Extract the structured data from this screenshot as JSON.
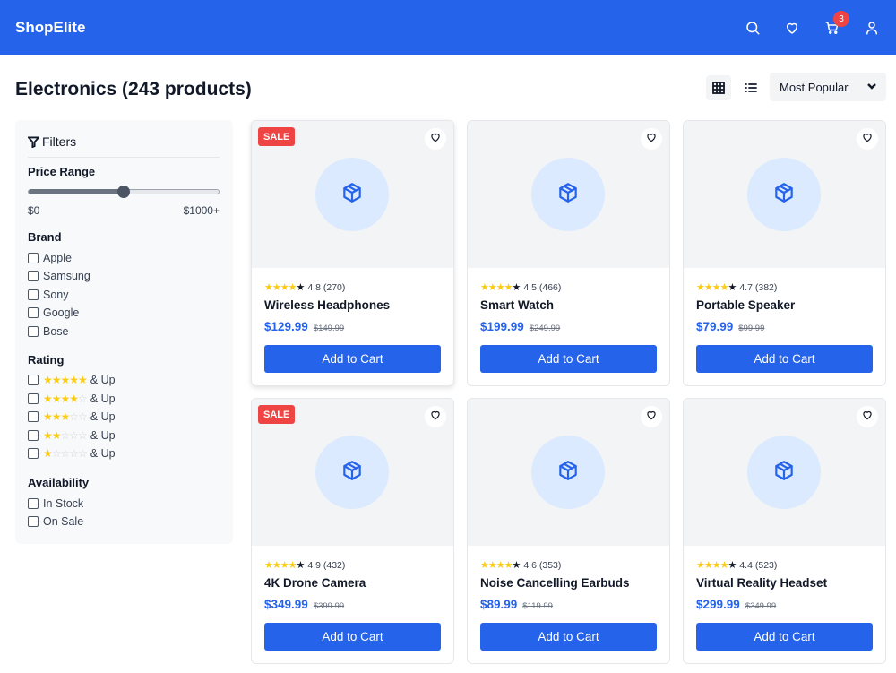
{
  "brand": "ShopElite",
  "header": {
    "icons": [
      "search-icon",
      "heart-icon",
      "cart-icon",
      "user-icon"
    ],
    "cart_count": "3",
    "accent": "#2563eb"
  },
  "page_title": "Electronics (243 products)",
  "sort": {
    "selected": "Most Popular"
  },
  "view_modes": [
    "grid-icon",
    "list-icon"
  ],
  "filters": {
    "title": "Filters",
    "price": {
      "title": "Price Range",
      "min_label": "$0",
      "max_label": "$1000+",
      "value_fraction": 0.5
    },
    "brand": {
      "title": "Brand",
      "options": [
        "Apple",
        "Samsung",
        "Sony",
        "Google",
        "Bose"
      ]
    },
    "rating": {
      "title": "Rating",
      "suffix": "& Up",
      "options": [
        5,
        4,
        3,
        2,
        1
      ]
    },
    "availability": {
      "title": "Availability",
      "options": [
        "In Stock",
        "On Sale"
      ]
    }
  },
  "products": [
    {
      "name": "Wireless Headphones",
      "rating": "4.8",
      "reviews": "(270)",
      "price": "$129.99",
      "old_price": "$149.99",
      "sale": true,
      "button": "Add to Cart"
    },
    {
      "name": "Smart Watch",
      "rating": "4.5",
      "reviews": "(466)",
      "price": "$199.99",
      "old_price": "$249.99",
      "sale": false,
      "button": "Add to Cart"
    },
    {
      "name": "Portable Speaker",
      "rating": "4.7",
      "reviews": "(382)",
      "price": "$79.99",
      "old_price": "$99.99",
      "sale": false,
      "button": "Add to Cart"
    },
    {
      "name": "4K Drone Camera",
      "rating": "4.9",
      "reviews": "(432)",
      "price": "$349.99",
      "old_price": "$399.99",
      "sale": true,
      "button": "Add to Cart"
    },
    {
      "name": "Noise Cancelling Earbuds",
      "rating": "4.6",
      "reviews": "(353)",
      "price": "$89.99",
      "old_price": "$119.99",
      "sale": false,
      "button": "Add to Cart"
    },
    {
      "name": "Virtual Reality Headset",
      "rating": "4.4",
      "reviews": "(523)",
      "price": "$299.99",
      "old_price": "$349.99",
      "sale": false,
      "button": "Add to Cart"
    }
  ],
  "sale_label": "SALE"
}
